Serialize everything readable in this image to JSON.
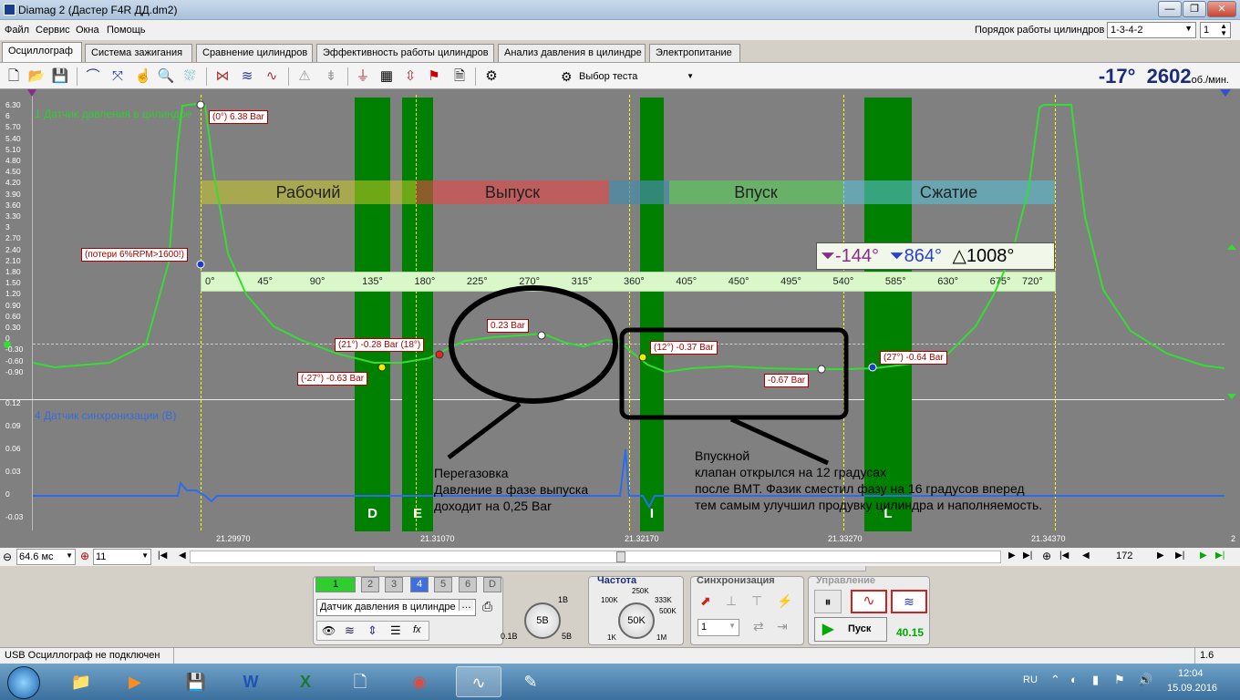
{
  "window": {
    "title": "Diamag 2 (Дастер F4R ДД.dm2)",
    "controls": [
      "—",
      "❐",
      "✕"
    ]
  },
  "menu": {
    "items": [
      "Файл",
      "Сервис",
      "Окна",
      "Помощь"
    ],
    "cyl_order_label": "Порядок работы цилиндров",
    "cyl_order_value": "1-3-4-2",
    "cyl_value": "1"
  },
  "tabs": [
    "Осциллограф",
    "Система зажигания",
    "Сравнение цилиндров",
    "Эффективность работы цилиндров",
    "Анализ давления в цилиндре",
    "Электропитание"
  ],
  "toolbar": {
    "test_select": "Выбор теста",
    "angle": "-17°",
    "rpm": "2602",
    "rpm_unit": "об./мин."
  },
  "plot": {
    "ch1_label": "1 Датчик давления в цилиндре",
    "ch4_label": "4 Датчик синхронизации (В)",
    "y1_ticks": [
      "6.30",
      "6",
      "5.70",
      "5.40",
      "5.10",
      "4.80",
      "4.50",
      "4.20",
      "3.90",
      "3.60",
      "3.30",
      "3",
      "2.70",
      "2.40",
      "2.10",
      "1.80",
      "1.50",
      "1.20",
      "0.90",
      "0.60",
      "0.30",
      "0",
      "-0.30",
      "-0.60",
      "-0.90"
    ],
    "y4_ticks": [
      "0.12",
      "0.09",
      "0.06",
      "0.03",
      "0",
      "-0.03"
    ],
    "phases": [
      "Рабочий",
      "Выпуск",
      "Впуск",
      "Сжатие"
    ],
    "bars": [
      "D",
      "E",
      "I",
      "L"
    ],
    "angles": [
      "0°",
      "45°",
      "90°",
      "135°",
      "180°",
      "225°",
      "270°",
      "315°",
      "360°",
      "405°",
      "450°",
      "495°",
      "540°",
      "585°",
      "630°",
      "675°",
      "720°"
    ],
    "markers": {
      "a": "-144°",
      "b": "864°",
      "delta": "1008°"
    },
    "annotations": {
      "peak": "(0°) 6.38 Bar",
      "loss": "(потери 6%RPM>1600!)",
      "exhaust_peak": "0.23 Bar",
      "pt21": "(21°) -0.28 Bar (18°)",
      "pt_neg27": "(-27°) -0.63 Bar",
      "pt12": "(12°) -0.37 Bar",
      "pt067": "-0.67 Bar",
      "pt27": "(27°) -0.64 Bar"
    },
    "note1": [
      "Перегазовка",
      "Давление в фазе выпуска",
      "доходит на 0,25 Bar"
    ],
    "note2": [
      "Впускной",
      "клапан открылся на 12 градусах",
      "после ВМТ. Фазик сместил фазу на 16 градусов вперед",
      "тем самым улучшил продувку цилиндра и наполняемость."
    ],
    "time_ticks": [
      "21.29970",
      "21.31070",
      "21.32170",
      "21.33270",
      "21.34370"
    ],
    "right_tick": "2"
  },
  "timeline": {
    "timebase": "64.6 мс",
    "count": "11",
    "frame": "172"
  },
  "controls": {
    "channels": [
      "1",
      "2",
      "3",
      "4",
      "5",
      "6",
      "D"
    ],
    "sensor": "Датчик давления в цилиндре",
    "volt_knob": "5В",
    "volt_min": "0.1В",
    "volt_max1": "1В",
    "volt_max2": "5В",
    "freq_title": "Частота",
    "freq_knob": "50K",
    "freq_labels": [
      "100K",
      "250K",
      "333K",
      "500K",
      "1K",
      "1M"
    ],
    "sync_title": "Синхронизация",
    "sync_value": "1",
    "mgmt_title": "Управление",
    "start": "Пуск",
    "fps": "40.15"
  },
  "status": {
    "text": "USB Осциллограф не подключен",
    "version": "1.6"
  },
  "taskbar": {
    "lang": "RU",
    "time": "12:04",
    "date": "15.09.2016"
  }
}
